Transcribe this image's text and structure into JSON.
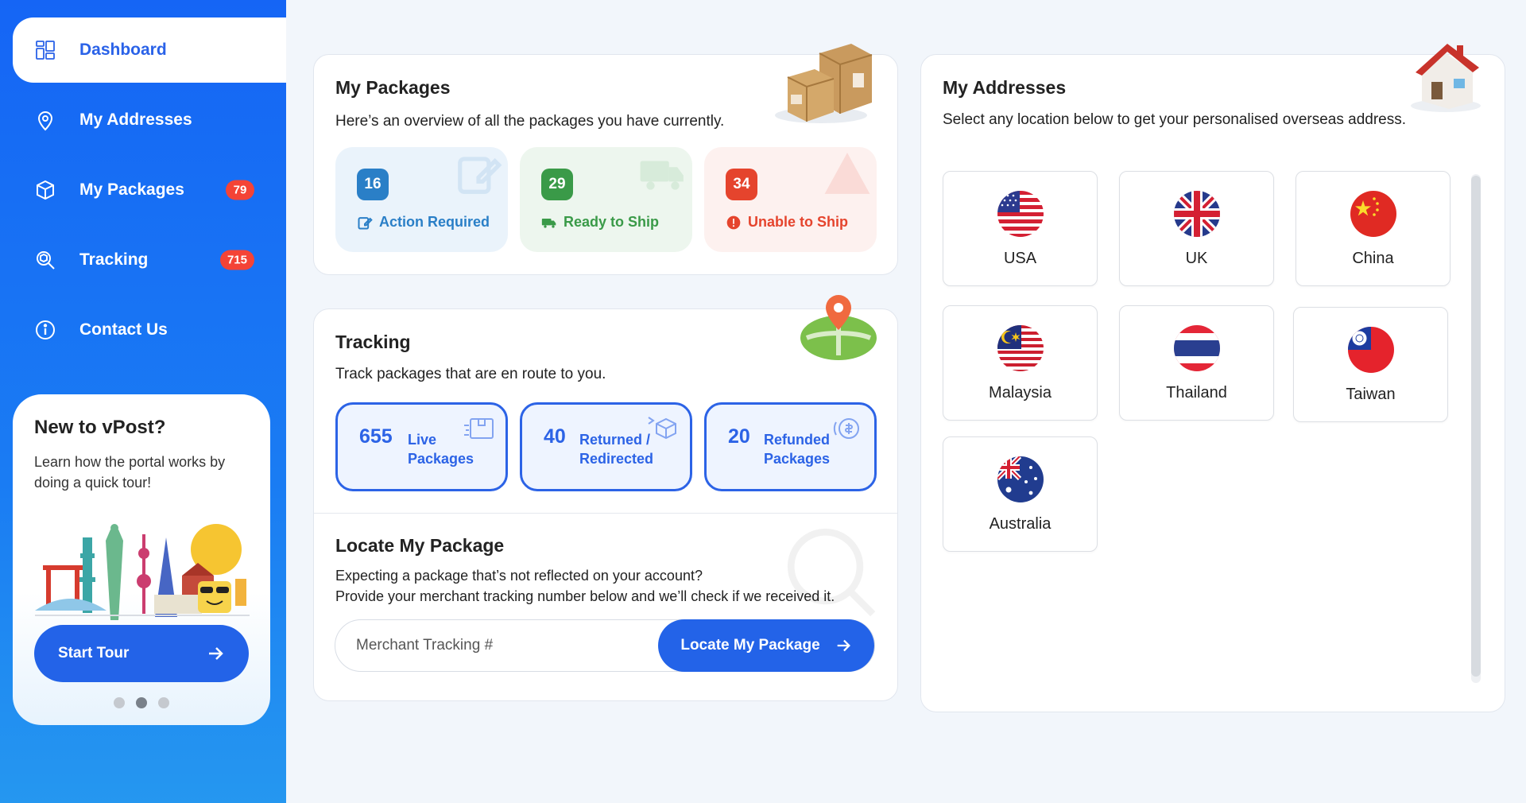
{
  "sidebar": {
    "items": [
      {
        "label": "Dashboard",
        "icon": "dashboard-icon",
        "active": true
      },
      {
        "label": "My Addresses",
        "icon": "location-pin-icon"
      },
      {
        "label": "My Packages",
        "icon": "package-icon",
        "badge": "79"
      },
      {
        "label": "Tracking",
        "icon": "tracking-icon",
        "badge": "715"
      },
      {
        "label": "Contact Us",
        "icon": "info-icon"
      }
    ],
    "tour": {
      "title": "New to vPost?",
      "description": "Learn how the portal works by doing a quick tour!",
      "button_label": "Start Tour",
      "slides": 3,
      "active_slide": 1
    }
  },
  "packages": {
    "title": "My Packages",
    "description": "Here’s an overview of all the packages you have currently.",
    "stats": [
      {
        "count": "16",
        "label": "Action Required",
        "color": "#2a7fc7",
        "bg": "#eaf3fb"
      },
      {
        "count": "29",
        "label": "Ready to Ship",
        "color": "#3a9a48",
        "bg": "#edf6ee"
      },
      {
        "count": "34",
        "label": "Unable to Ship",
        "color": "#e5442d",
        "bg": "#fdf1ef"
      }
    ]
  },
  "tracking": {
    "title": "Tracking",
    "description": "Track packages that are en route to you.",
    "stats": [
      {
        "count": "655",
        "label1": "Live",
        "label2": "Packages"
      },
      {
        "count": "40",
        "label1": "Returned /",
        "label2": "Redirected"
      },
      {
        "count": "20",
        "label1": "Refunded",
        "label2": "Packages"
      }
    ],
    "locate": {
      "title": "Locate My Package",
      "line1": "Expecting a package that’s not reflected on your account?",
      "line2": "Provide your merchant tracking number below and we’ll check if we received it.",
      "placeholder": "Merchant Tracking #",
      "button_label": "Locate My Package"
    }
  },
  "addresses": {
    "title": "My Addresses",
    "description": "Select any location below to get your personalised overseas address.",
    "locations": [
      "USA",
      "UK",
      "China",
      "Malaysia",
      "Thailand",
      "Taiwan",
      "Australia"
    ]
  },
  "colors": {
    "primary": "#2363e8",
    "sidebar": "#1565f5",
    "badge": "#f44336"
  }
}
